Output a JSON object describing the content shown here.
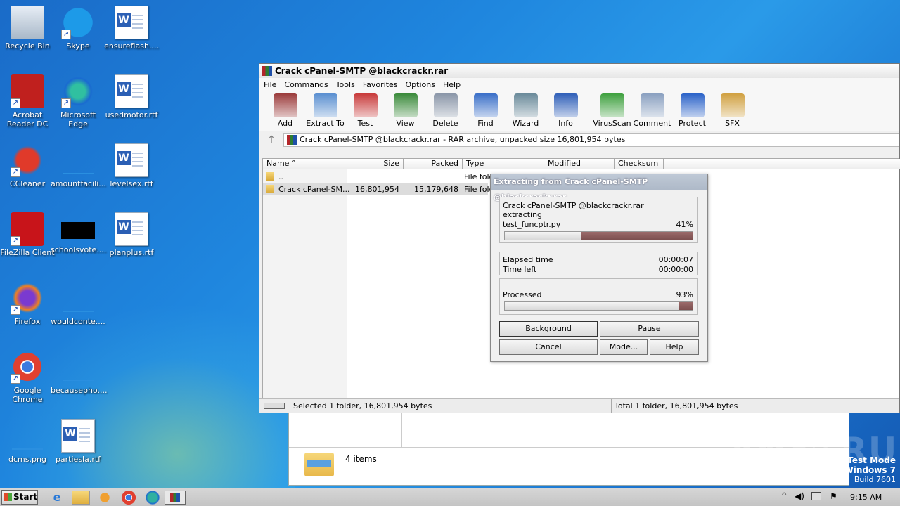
{
  "desktop": {
    "icons": [
      {
        "label": "Recycle Bin",
        "icon": "recycle-bin-icon",
        "shortcut": false
      },
      {
        "label": "Skype",
        "icon": "skype-icon",
        "shortcut": true
      },
      {
        "label": "ensureflash....",
        "icon": "word-doc-icon",
        "shortcut": false
      },
      {
        "label": "Acrobat\nReader DC",
        "icon": "acrobat-icon",
        "shortcut": true
      },
      {
        "label": "Microsoft Edge",
        "icon": "edge-icon",
        "shortcut": true
      },
      {
        "label": "usedmotor.rtf",
        "icon": "word-doc-icon",
        "shortcut": false
      },
      {
        "label": "CCleaner",
        "icon": "ccleaner-icon",
        "shortcut": true
      },
      {
        "label": "amountfacili...",
        "icon": "blank-file-icon",
        "shortcut": false
      },
      {
        "label": "levelsex.rtf",
        "icon": "word-doc-icon",
        "shortcut": false
      },
      {
        "label": "FileZilla Client",
        "icon": "filezilla-icon",
        "shortcut": true
      },
      {
        "label": "schoolsvote....",
        "icon": "black-thumbnail-icon",
        "shortcut": false
      },
      {
        "label": "planplus.rtf",
        "icon": "word-doc-icon",
        "shortcut": false
      },
      {
        "label": "Firefox",
        "icon": "firefox-icon",
        "shortcut": true
      },
      {
        "label": "wouldconte....",
        "icon": "blank-file-icon",
        "shortcut": false
      },
      {
        "label": "Google\nChrome",
        "icon": "chrome-icon",
        "shortcut": true
      },
      {
        "label": "becausepho....",
        "icon": "blank-file-icon",
        "shortcut": false
      },
      {
        "label": "dcms.png",
        "icon": "blank-file-icon",
        "shortcut": false
      },
      {
        "label": "partiesla.rtf",
        "icon": "word-doc-icon",
        "shortcut": false
      }
    ],
    "watermark": {
      "brand": "ANY▷RUN",
      "line1": "Test Mode",
      "line2": "Windows 7",
      "line3": "Build 7601"
    }
  },
  "explorer_bg": {
    "items_count": "4 items"
  },
  "winrar": {
    "title": "Crack cPanel-SMTP @blackcrackr.rar",
    "menu": [
      "File",
      "Commands",
      "Tools",
      "Favorites",
      "Options",
      "Help"
    ],
    "toolbar": [
      {
        "label": "Add",
        "icon": "add-archive-icon",
        "color": "#9b3b3b"
      },
      {
        "label": "Extract To",
        "icon": "extract-folder-icon",
        "color": "#5a8fd0"
      },
      {
        "label": "Test",
        "icon": "test-clipboard-icon",
        "color": "#c83a3a"
      },
      {
        "label": "View",
        "icon": "view-book-icon",
        "color": "#3a8a3a"
      },
      {
        "label": "Delete",
        "icon": "delete-bin-icon",
        "color": "#8a96a8"
      },
      {
        "label": "Find",
        "icon": "find-magnifier-icon",
        "color": "#3a6fc8"
      },
      {
        "label": "Wizard",
        "icon": "wizard-wand-icon",
        "color": "#6a8a9a"
      },
      {
        "label": "Info",
        "icon": "info-icon",
        "color": "#2f5fb8"
      },
      {
        "label": "VirusScan",
        "icon": "virusscan-bug-icon",
        "color": "#3ea03e"
      },
      {
        "label": "Comment",
        "icon": "comment-icon",
        "color": "#8aa0c0"
      },
      {
        "label": "Protect",
        "icon": "protect-shield-icon",
        "color": "#2a62c8"
      },
      {
        "label": "SFX",
        "icon": "sfx-box-icon",
        "color": "#d0a040"
      }
    ],
    "address": "Crack cPanel-SMTP @blackcrackr.rar - RAR archive, unpacked size 16,801,954 bytes",
    "columns": [
      "Name",
      "Size",
      "Packed",
      "Type",
      "Modified",
      "Checksum"
    ],
    "rows": [
      {
        "name": "..",
        "size": "",
        "packed": "",
        "type": "File fold"
      },
      {
        "name": "Crack cPanel-SM...",
        "size": "16,801,954",
        "packed": "15,179,648",
        "type": "File fold"
      }
    ],
    "status_left": "Selected 1 folder, 16,801,954 bytes",
    "status_right": "Total 1 folder, 16,801,954 bytes"
  },
  "extract_dialog": {
    "title": "Extracting from Crack cPanel-SMTP @blackcrackr.rar",
    "archive": "Crack cPanel-SMTP @blackcrackr.rar",
    "action": "extracting",
    "file": "test_funcptr.py",
    "file_percent": "41%",
    "file_progress": 0.41,
    "elapsed_label": "Elapsed time",
    "elapsed": "00:00:07",
    "left_label": "Time left",
    "left": "00:00:00",
    "processed_label": "Processed",
    "processed_percent": "93%",
    "processed_progress": 0.93,
    "buttons": {
      "background": "Background",
      "pause": "Pause",
      "cancel": "Cancel",
      "mode": "Mode...",
      "help": "Help"
    }
  },
  "taskbar": {
    "start": "Start",
    "time": "9:15 AM"
  }
}
